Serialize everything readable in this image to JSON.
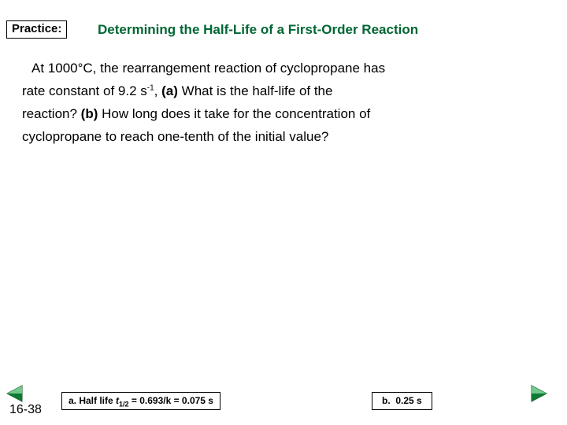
{
  "header": {
    "practice_label": "Practice:",
    "title": "Determining the Half-Life of a First-Order Reaction"
  },
  "body": {
    "line1": "At 1000°C, the rearrangement reaction of cyclopropane has",
    "line2_a": "rate constant of 9.2 s",
    "line2_sup": "-1",
    "line2_b": ",",
    "line2_bold_a": "(a)",
    "line2_c": "What is the half-life of the",
    "line3_a": "reaction?",
    "line3_bold_b": "(b)",
    "line3_b": "How long does it take for the concentration of",
    "line4": "cyclopropane to reach one-tenth of the initial value?"
  },
  "footer": {
    "slide_number": "16-38",
    "answer_a_prefix": "a. Half life ",
    "answer_a_sym": "t",
    "answer_a_sub": "1/2",
    "answer_a_suffix": " = 0.693/k = 0.075 s",
    "answer_b_label": "b.",
    "answer_b_value": "0.25 s"
  },
  "icons": {
    "prev": "triangle-left-icon",
    "next": "triangle-right-icon"
  },
  "colors": {
    "title_green": "#006633",
    "arrow_green": "#1E8449",
    "text_black": "#000000",
    "background": "#FFFFFF"
  }
}
